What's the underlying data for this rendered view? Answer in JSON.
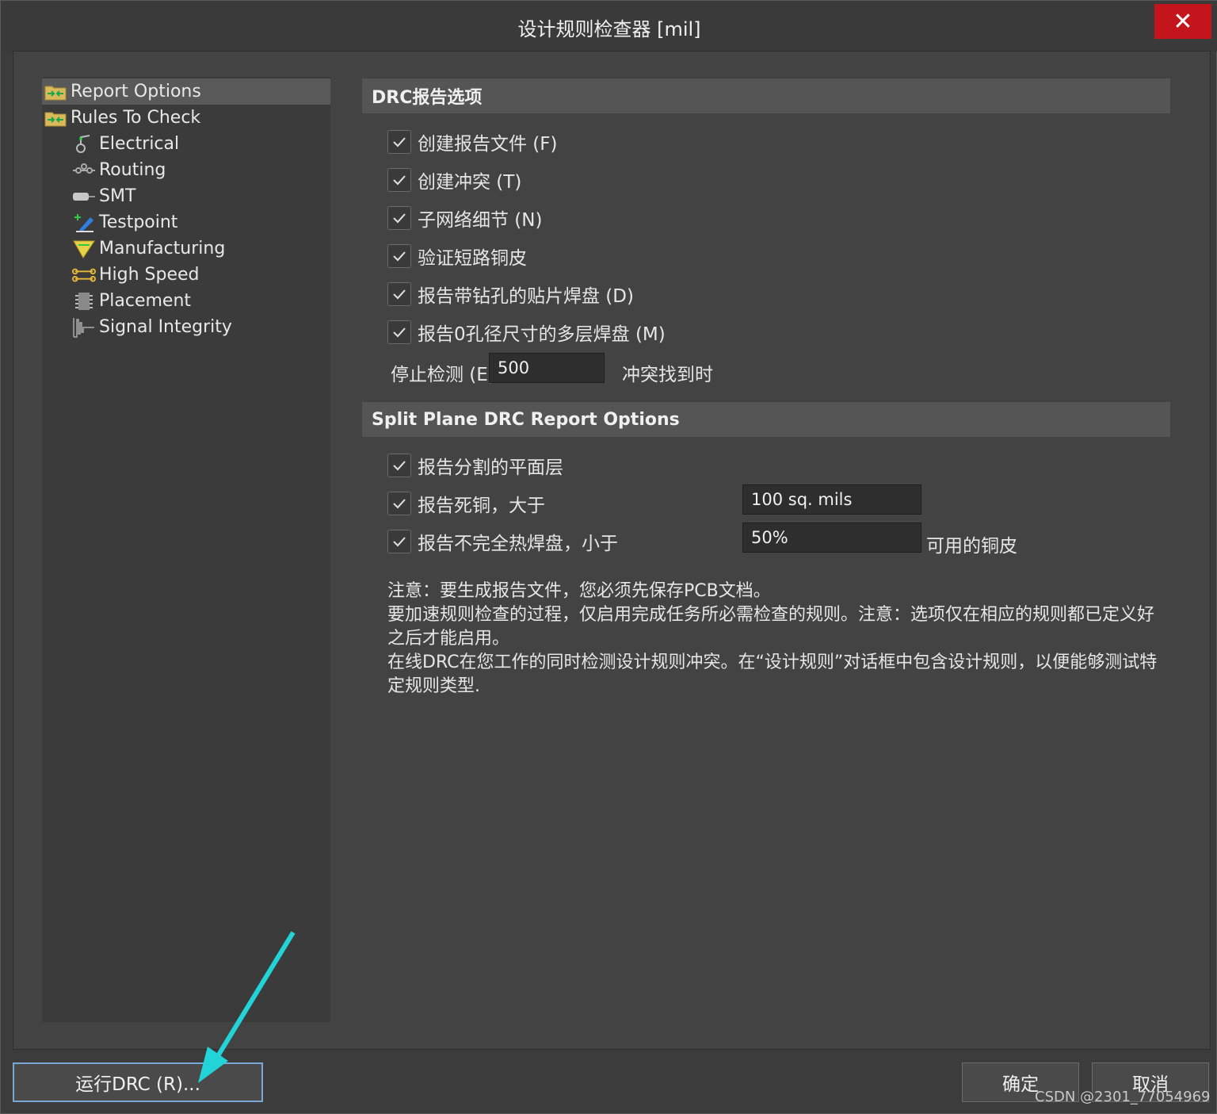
{
  "window": {
    "title": "设计规则检查器 [mil]",
    "close_label": "✕"
  },
  "tree": {
    "items": [
      {
        "label": "Report Options",
        "icon": "folder-icon"
      },
      {
        "label": "Rules To Check",
        "icon": "folder-icon"
      },
      {
        "label": "Electrical",
        "icon": "electrical-icon"
      },
      {
        "label": "Routing",
        "icon": "routing-icon"
      },
      {
        "label": "SMT",
        "icon": "smt-icon"
      },
      {
        "label": "Testpoint",
        "icon": "testpoint-icon"
      },
      {
        "label": "Manufacturing",
        "icon": "manufacturing-icon"
      },
      {
        "label": "High Speed",
        "icon": "high-speed-icon"
      },
      {
        "label": "Placement",
        "icon": "placement-icon"
      },
      {
        "label": "Signal Integrity",
        "icon": "signal-integrity-icon"
      }
    ]
  },
  "drc_section": {
    "header": "DRC报告选项",
    "checkboxes": [
      {
        "label": "创建报告文件 (F)",
        "checked": true
      },
      {
        "label": "创建冲突 (T)",
        "checked": true
      },
      {
        "label": "子网络细节 (N)",
        "checked": true
      },
      {
        "label": "验证短路铜皮",
        "checked": true
      },
      {
        "label": "报告带钻孔的贴片焊盘 (D)",
        "checked": true
      },
      {
        "label": "报告0孔径尺寸的多层焊盘 (M)",
        "checked": true
      }
    ],
    "stop_label": "停止检测 (E)",
    "stop_value": "500",
    "stop_suffix": "冲突找到时"
  },
  "split_section": {
    "header": "Split Plane DRC Report Options",
    "checkboxes": [
      {
        "label": "报告分割的平面层",
        "checked": true
      },
      {
        "label": "报告死铜，大于",
        "checked": true
      },
      {
        "label": "报告不完全热焊盘，小于",
        "checked": true
      }
    ],
    "dead_copper_value": "100 sq. mils",
    "thermal_value": "50%",
    "thermal_suffix": "可用的铜皮"
  },
  "notes": [
    "注意：要生成报告文件，您必须先保存PCB文档。",
    "要加速规则检查的过程，仅启用完成任务所必需检查的规则。注意：选项仅在相应的规则都已定义好之后才能启用。",
    "在线DRC在您工作的同时检测设计规则冲突。在“设计规则”对话框中包含设计规则，以便能够测试特定规则类型."
  ],
  "footer": {
    "run_label": "运行DRC (R)...",
    "ok_label": "确定",
    "cancel_label": "取消"
  },
  "watermark": "CSDN @2301_77054969",
  "colors": {
    "close": "#c4151c",
    "accent_arrow": "#22d3d8",
    "check": "#e0e0e0"
  }
}
